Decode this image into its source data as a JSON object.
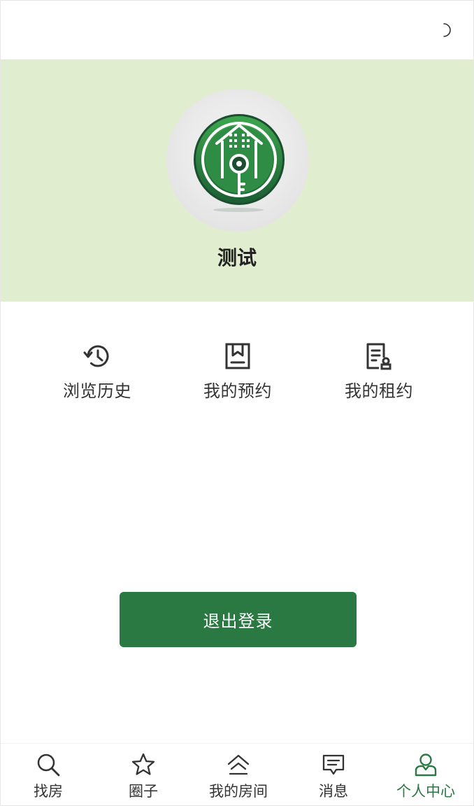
{
  "header": {
    "theme_toggle_icon": "moon-icon"
  },
  "profile": {
    "avatar_icon": "house-key-logo",
    "username": "测试",
    "banner_color": "#e1edcf"
  },
  "quick_actions": [
    {
      "label": "浏览历史",
      "icon": "history-icon"
    },
    {
      "label": "我的预约",
      "icon": "bookmark-icon"
    },
    {
      "label": "我的租约",
      "icon": "contract-icon"
    }
  ],
  "logout": {
    "label": "退出登录",
    "color": "#2a7842"
  },
  "tabbar": {
    "active_color": "#2a7842",
    "items": [
      {
        "label": "找房",
        "icon": "search-icon"
      },
      {
        "label": "圈子",
        "icon": "star-icon"
      },
      {
        "label": "我的房间",
        "icon": "home-icon"
      },
      {
        "label": "消息",
        "icon": "message-icon"
      },
      {
        "label": "个人中心",
        "icon": "user-icon",
        "active": true
      }
    ]
  }
}
